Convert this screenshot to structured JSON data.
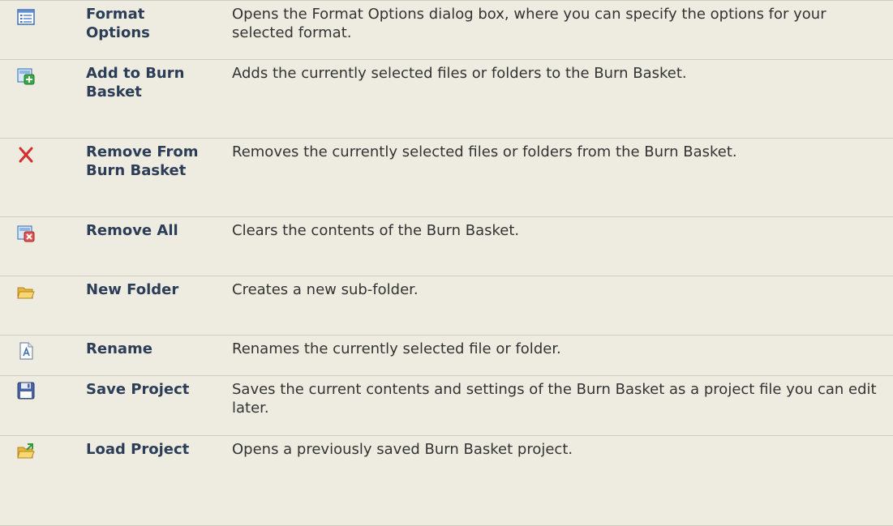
{
  "rows": [
    {
      "icon": "format-options-icon",
      "name": "Format Options",
      "description": "Opens the Format Options dialog box, where you can specify the options for your selected format."
    },
    {
      "icon": "add-to-basket-icon",
      "name": "Add to Burn Basket",
      "description": "Adds the currently selected files or folders to the Burn Basket."
    },
    {
      "icon": "remove-x-icon",
      "name": "Remove From Burn Basket",
      "description": "Removes the currently selected files or folders from the Burn Basket."
    },
    {
      "icon": "remove-all-icon",
      "name": "Remove All",
      "description": "Clears the contents of the Burn Basket."
    },
    {
      "icon": "new-folder-icon",
      "name": "New Folder",
      "description": "Creates a new sub-folder."
    },
    {
      "icon": "rename-icon",
      "name": "Rename",
      "description": "Renames the currently selected file or folder."
    },
    {
      "icon": "save-disk-icon",
      "name": "Save Project",
      "description": "Saves the current contents and settings of the Burn Basket as a project file you can edit later."
    },
    {
      "icon": "load-folder-icon",
      "name": "Load Project",
      "description": "Opens a previously saved Burn Basket project."
    }
  ]
}
